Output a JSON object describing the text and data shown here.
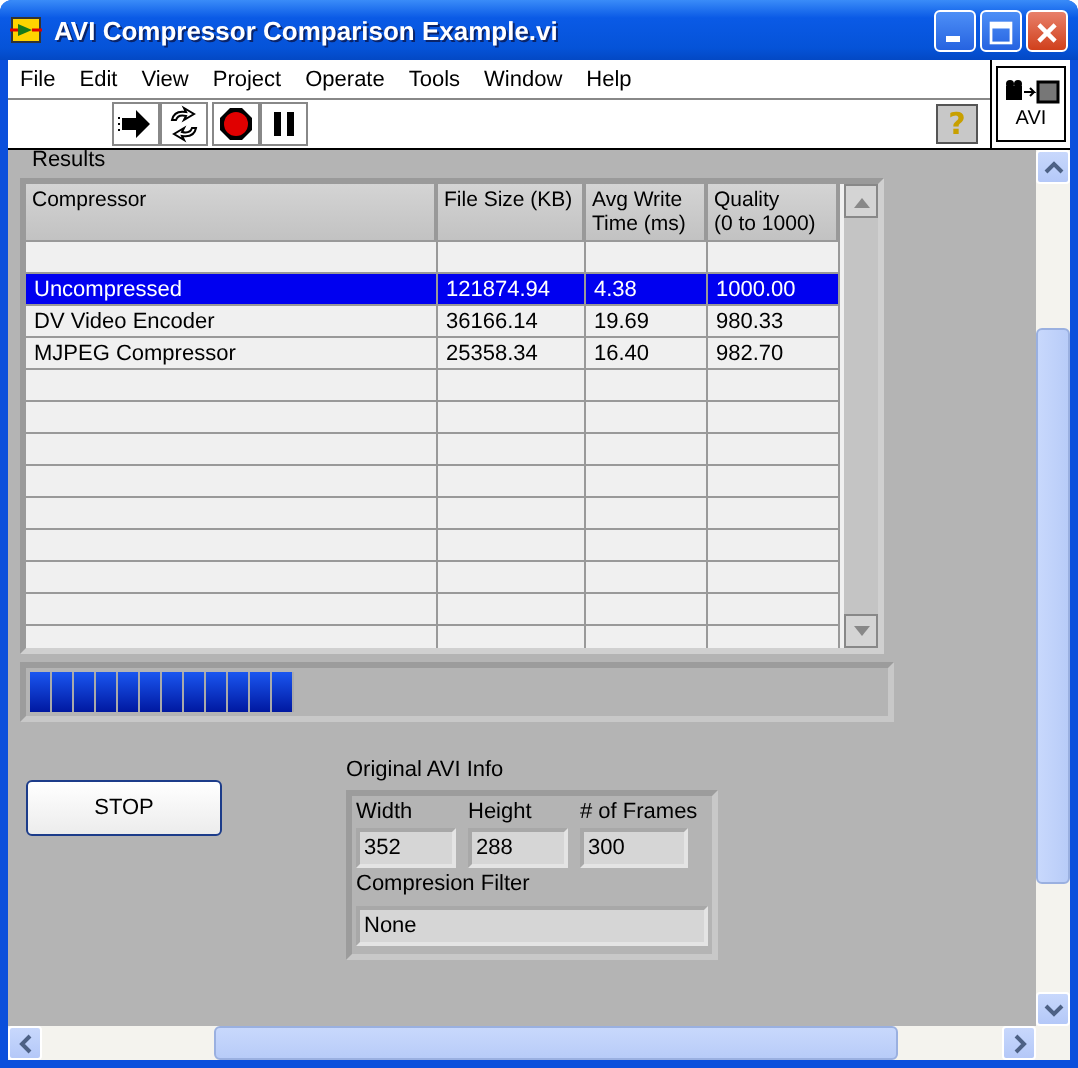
{
  "window": {
    "title": "AVI Compressor Comparison Example.vi"
  },
  "menu": [
    {
      "label": "File"
    },
    {
      "label": "Edit"
    },
    {
      "label": "View"
    },
    {
      "label": "Project"
    },
    {
      "label": "Operate"
    },
    {
      "label": "Tools"
    },
    {
      "label": "Window"
    },
    {
      "label": "Help"
    }
  ],
  "help_button": {
    "label": "?"
  },
  "vi_icon": {
    "label": "AVI"
  },
  "results": {
    "label": "Results",
    "columns": [
      "Compressor",
      "File Size (KB)",
      "Avg Write\nTime (ms)",
      "Quality\n(0 to 1000)"
    ],
    "rows": [
      {
        "cells": [
          "Uncompressed",
          "121874.94",
          "4.38",
          "1000.00"
        ],
        "selected": true
      },
      {
        "cells": [
          "DV Video Encoder",
          "36166.14",
          "19.69",
          "980.33"
        ],
        "selected": false
      },
      {
        "cells": [
          "MJPEG Compressor",
          "25358.34",
          "16.40",
          "982.70"
        ],
        "selected": false
      }
    ]
  },
  "progress": {
    "level": 0.31
  },
  "stop_button": {
    "label": "STOP"
  },
  "avi_info": {
    "label": "Original AVI Info",
    "fields": [
      {
        "label": "Width",
        "value": "352"
      },
      {
        "label": "Height",
        "value": "288"
      },
      {
        "label": "# of Frames",
        "value": "300"
      }
    ],
    "filter": {
      "label": "Compresion Filter",
      "value": "None"
    }
  }
}
